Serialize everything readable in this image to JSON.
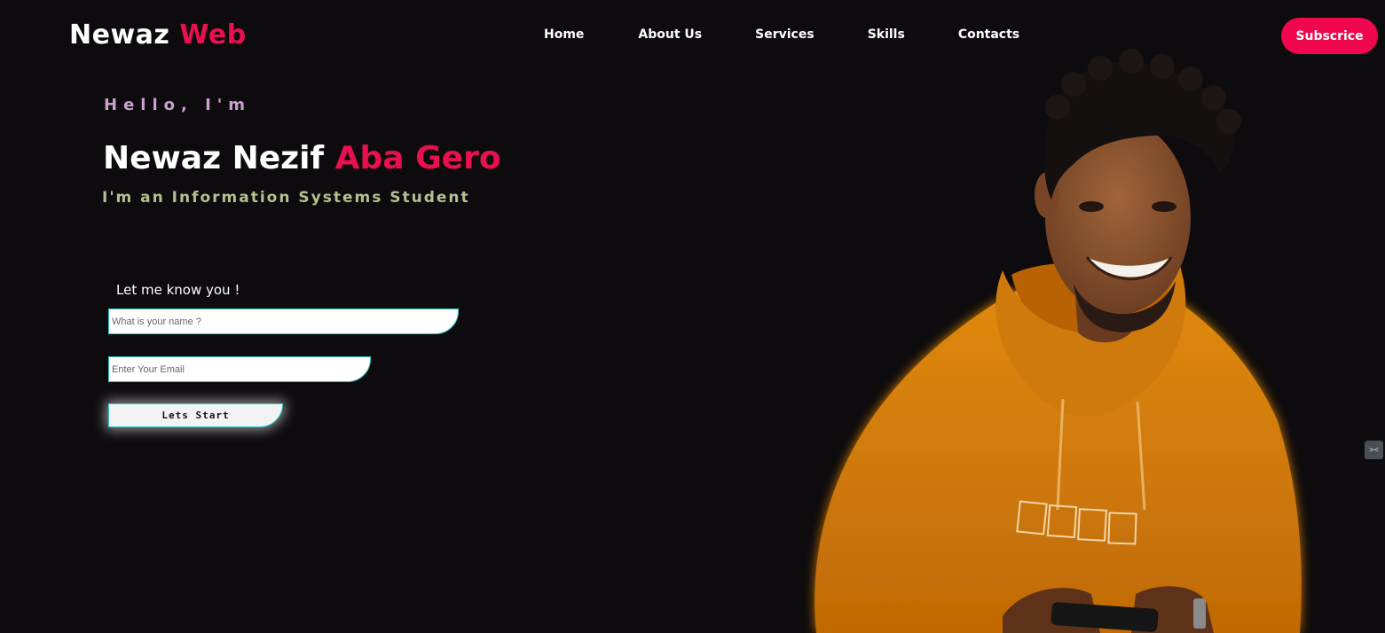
{
  "header": {
    "logo_part1": "Newaz",
    "logo_part2": "Web",
    "nav": [
      "Home",
      "About Us",
      "Services",
      "Skills",
      "Contacts"
    ],
    "subscribe_label": "Subscrice"
  },
  "hero": {
    "greeting": "Hello, I'm",
    "name_first": "Newaz Nezif",
    "name_last": "Aba Gero",
    "role": "I'm an Information Systems Student"
  },
  "form": {
    "title": "Let me know you !",
    "name_placeholder": "What is your name ?",
    "email_placeholder": "Enter Your Email",
    "button_label": "Lets Start"
  },
  "colors": {
    "background": "#0d0b0d",
    "accent": "#e8104f",
    "greeting": "#c9a0cf",
    "role": "#b4c08e",
    "input_border": "#2ecbd0",
    "hoodie": "#d17a08"
  },
  "photo": {
    "description_icon": "person-photo"
  }
}
